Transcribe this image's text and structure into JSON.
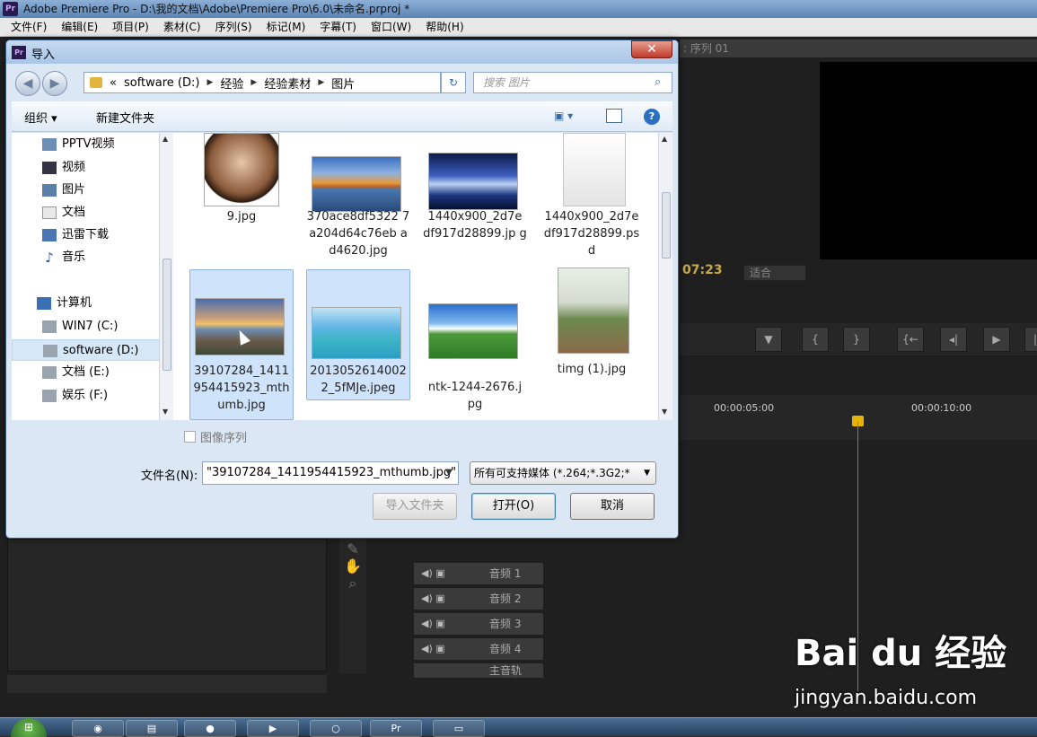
{
  "app": {
    "window_title": "Adobe Premiere Pro - D:\\我的文档\\Adobe\\Premiere Pro\\6.0\\未命名.prproj *",
    "logo": "Pr",
    "menu": [
      "文件(F)",
      "编辑(E)",
      "项目(P)",
      "素材(C)",
      "序列(S)",
      "标记(M)",
      "字幕(T)",
      "窗口(W)",
      "帮助(H)"
    ],
    "monitor_tab": ": 序列 01",
    "timecode": "07:23",
    "fit": "适合",
    "ruler": [
      "00:00:05:00",
      "00:00:10:00"
    ],
    "tracks": [
      "音频 1",
      "音频 2",
      "音频 3",
      "音频 4",
      "主音轨"
    ]
  },
  "dialog": {
    "title": "导入",
    "close": "✕",
    "breadcrumb": {
      "prefix": "«",
      "parts": [
        "software (D:)",
        "经验",
        "经验素材",
        "图片"
      ]
    },
    "search_placeholder": "搜索 图片",
    "toolbar": {
      "organize": "组织 ▾",
      "new_folder": "新建文件夹",
      "help": "?"
    },
    "nav_items": [
      {
        "label": "PPTV视频",
        "icon": "video-folder-icon"
      },
      {
        "label": "视频",
        "icon": "video-library-icon"
      },
      {
        "label": "图片",
        "icon": "picture-library-icon"
      },
      {
        "label": "文档",
        "icon": "document-library-icon"
      },
      {
        "label": "迅雷下载",
        "icon": "download-folder-icon"
      },
      {
        "label": "音乐",
        "icon": "music-library-icon"
      },
      {
        "label": "计算机",
        "icon": "computer-icon"
      },
      {
        "label": "WIN7 (C:)",
        "icon": "drive-icon"
      },
      {
        "label": "software (D:)",
        "icon": "drive-icon",
        "selected": true
      },
      {
        "label": "文档 (E:)",
        "icon": "drive-icon"
      },
      {
        "label": "娱乐 (F:)",
        "icon": "drive-icon"
      }
    ],
    "files": [
      {
        "name": "9.jpg",
        "selected": false
      },
      {
        "name": "370ace8df5322 7a204d64c76eb ad4620.jpg",
        "selected": false
      },
      {
        "name": "1440x900_2d7e df917d28899.jp g",
        "selected": false
      },
      {
        "name": "1440x900_2d7e df917d28899.ps d",
        "selected": false
      },
      {
        "name": "39107284_1411 954415923_mth umb.jpg",
        "selected": true
      },
      {
        "name": "2013052614002 2_5fMJe.jpeg",
        "selected": true
      },
      {
        "name": "ntk-1244-2676.j pg",
        "selected": false
      },
      {
        "name": "timg (1).jpg",
        "selected": false
      }
    ],
    "image_sequence_label": "图像序列",
    "filename_label": "文件名(N):",
    "filename_value": "\"39107284_1411954415923_mthumb.jpg\"",
    "filetype_value": "所有可支持媒体 (*.264;*.3G2;*",
    "buttons": {
      "import_folder": "导入文件夹",
      "open": "打开(O)",
      "cancel": "取消"
    }
  },
  "watermark": {
    "brand": "Bai du 经验",
    "url": "jingyan.baidu.com"
  },
  "colors": {
    "selection": "#cfe3fa",
    "playhead": "#d05a3a",
    "timecode": "#c8a94a"
  }
}
